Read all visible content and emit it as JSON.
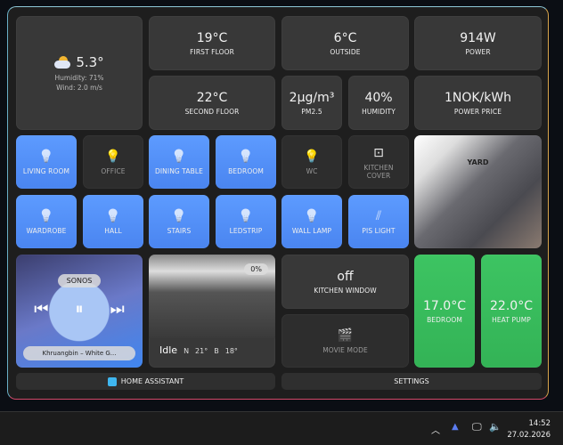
{
  "weather": {
    "icon": "partly-cloudy-icon",
    "temp": "5.3°",
    "humidity": "Humidity: 71%",
    "wind": "Wind: 2.0 m/s"
  },
  "sensors": [
    {
      "value": "19°C",
      "label": "FIRST FLOOR"
    },
    {
      "value": "6°C",
      "label": "OUTSIDE"
    },
    {
      "value": "914W",
      "label": "POWER"
    },
    {
      "value": "22°C",
      "label": "SECOND FLOOR"
    },
    {
      "value": "2µg/m³",
      "label": "PM2.5"
    },
    {
      "value": "40%",
      "label": "HUMIDITY"
    },
    {
      "value": "1NOK/kWh",
      "label": "POWER PRICE"
    }
  ],
  "lights": [
    {
      "label": "LIVING ROOM",
      "on": true
    },
    {
      "label": "OFFICE",
      "on": false
    },
    {
      "label": "DINING TABLE",
      "on": true
    },
    {
      "label": "BEDROOM",
      "on": true
    },
    {
      "label": "WC",
      "on": false
    },
    {
      "label": "KITCHEN COVER",
      "on": false
    },
    {
      "label": "WARDROBE",
      "on": true
    },
    {
      "label": "HALL",
      "on": true
    },
    {
      "label": "STAIRS",
      "on": true
    },
    {
      "label": "LEDSTRIP",
      "on": true
    },
    {
      "label": "WALL LAMP",
      "on": true
    },
    {
      "label": "PIS LIGHT",
      "on": true
    }
  ],
  "yard": {
    "label": "YARD"
  },
  "sonos": {
    "name": "SONOS",
    "track": "Khruangbin – White G..."
  },
  "vacuum": {
    "battery": "0%",
    "state": "Idle",
    "n": "N",
    "n_val": "21°",
    "b": "B",
    "b_val": "18°"
  },
  "kitchen_window": {
    "value": "off",
    "label": "KITCHEN WINDOW"
  },
  "movie_mode": {
    "label": "MOVIE MODE"
  },
  "climate": [
    {
      "value": "17.0°C",
      "label": "BEDROOM"
    },
    {
      "value": "22.0°C",
      "label": "HEAT PUMP"
    }
  ],
  "footer": {
    "home": "HOME ASSISTANT",
    "settings": "SETTINGS"
  },
  "taskbar": {
    "time": "14:52",
    "date": "27.02.2026"
  },
  "colors": {
    "accent_blue": "#5d9bff",
    "green": "#3dc462",
    "tile": "#383838"
  }
}
